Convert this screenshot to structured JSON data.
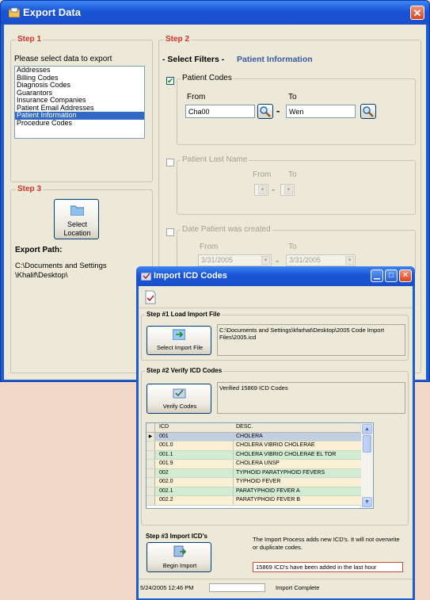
{
  "export": {
    "title": "Export Data",
    "close": "✕",
    "step1": {
      "legend": "Step 1",
      "prompt": "Please select data to export",
      "items": [
        "Addresses",
        "Billing Codes",
        "Diagnosis Codes",
        "Guarantors",
        "Insurance Companies",
        "Patient Email Addresses",
        "Patient Information",
        "Procedure Codes"
      ],
      "selected_index": 6
    },
    "step2": {
      "legend": "Step 2",
      "select_filters": "- Select Filters -",
      "filter_name": "Patient Information",
      "patient_codes": {
        "label": "Patient Codes",
        "checked": true,
        "from_label": "From",
        "to_label": "To",
        "from_value": "Cha00",
        "to_value": "Wen"
      },
      "last_name": {
        "label": "Patient Last Name",
        "checked": false,
        "from_label": "From",
        "to_label": "To"
      },
      "date_created": {
        "label": "Date Patient was created",
        "checked": false,
        "from_label": "From",
        "to_label": "To",
        "from_value": "3/31/2005",
        "to_value": "3/31/2005"
      }
    },
    "step3": {
      "legend": "Step 3",
      "button_label": "Select\nLocation",
      "export_path_label": "Export Path:",
      "export_path": "C:\\Documents and Settings\\Khalif\\Desktop\\"
    }
  },
  "import": {
    "title": "Import ICD Codes",
    "step1": {
      "legend": "Step #1  Load Import File",
      "button": "Select Import File",
      "path": "C:\\Documents and Settings\\kfarhat\\Desktop\\2005 Code Import Files\\2005.icd"
    },
    "step2": {
      "legend": "Step #2  Verify ICD Codes",
      "button": "Verify Codes",
      "result": "Verified 15869 ICD Codes"
    },
    "grid": {
      "headers": [
        "ICD",
        "DESC."
      ],
      "rows": [
        {
          "icd": "001",
          "desc": "CHOLERA",
          "bg": "#c2cfe0",
          "current": true
        },
        {
          "icd": "001.0",
          "desc": "CHOLERA VIBRIO CHOLERAE",
          "bg": "#fbefd6"
        },
        {
          "icd": "001.1",
          "desc": "CHOLERA VIBRIO CHOLERAE EL TOR",
          "bg": "#d2ecd2"
        },
        {
          "icd": "001.9",
          "desc": "CHOLERA UNSP",
          "bg": "#fbefd6"
        },
        {
          "icd": "002",
          "desc": "TYPHOID PARATYPHOID FEVERS",
          "bg": "#d2ecd2"
        },
        {
          "icd": "002.0",
          "desc": "TYPHOID FEVER",
          "bg": "#fbefd6"
        },
        {
          "icd": "002.1",
          "desc": "PARATYPHOID FEVER A",
          "bg": "#d2ecd2"
        },
        {
          "icd": "002.2",
          "desc": "PARATYPHOID FEVER B",
          "bg": "#fbefd6"
        }
      ]
    },
    "step3": {
      "legend": "Step #3  Import ICD's",
      "button": "Begin Import",
      "description": "The Import Process adds new ICD's. It will not overwrite or duplicate codes.",
      "result": "15869 ICD's have been added in the last hour"
    },
    "status": {
      "datetime": "5/24/2005 12:46 PM",
      "message": "Import Complete"
    }
  },
  "colors": {
    "accent": "#d0312a",
    "title_bar": "#1d5bd0",
    "selection": "#316ac5"
  }
}
